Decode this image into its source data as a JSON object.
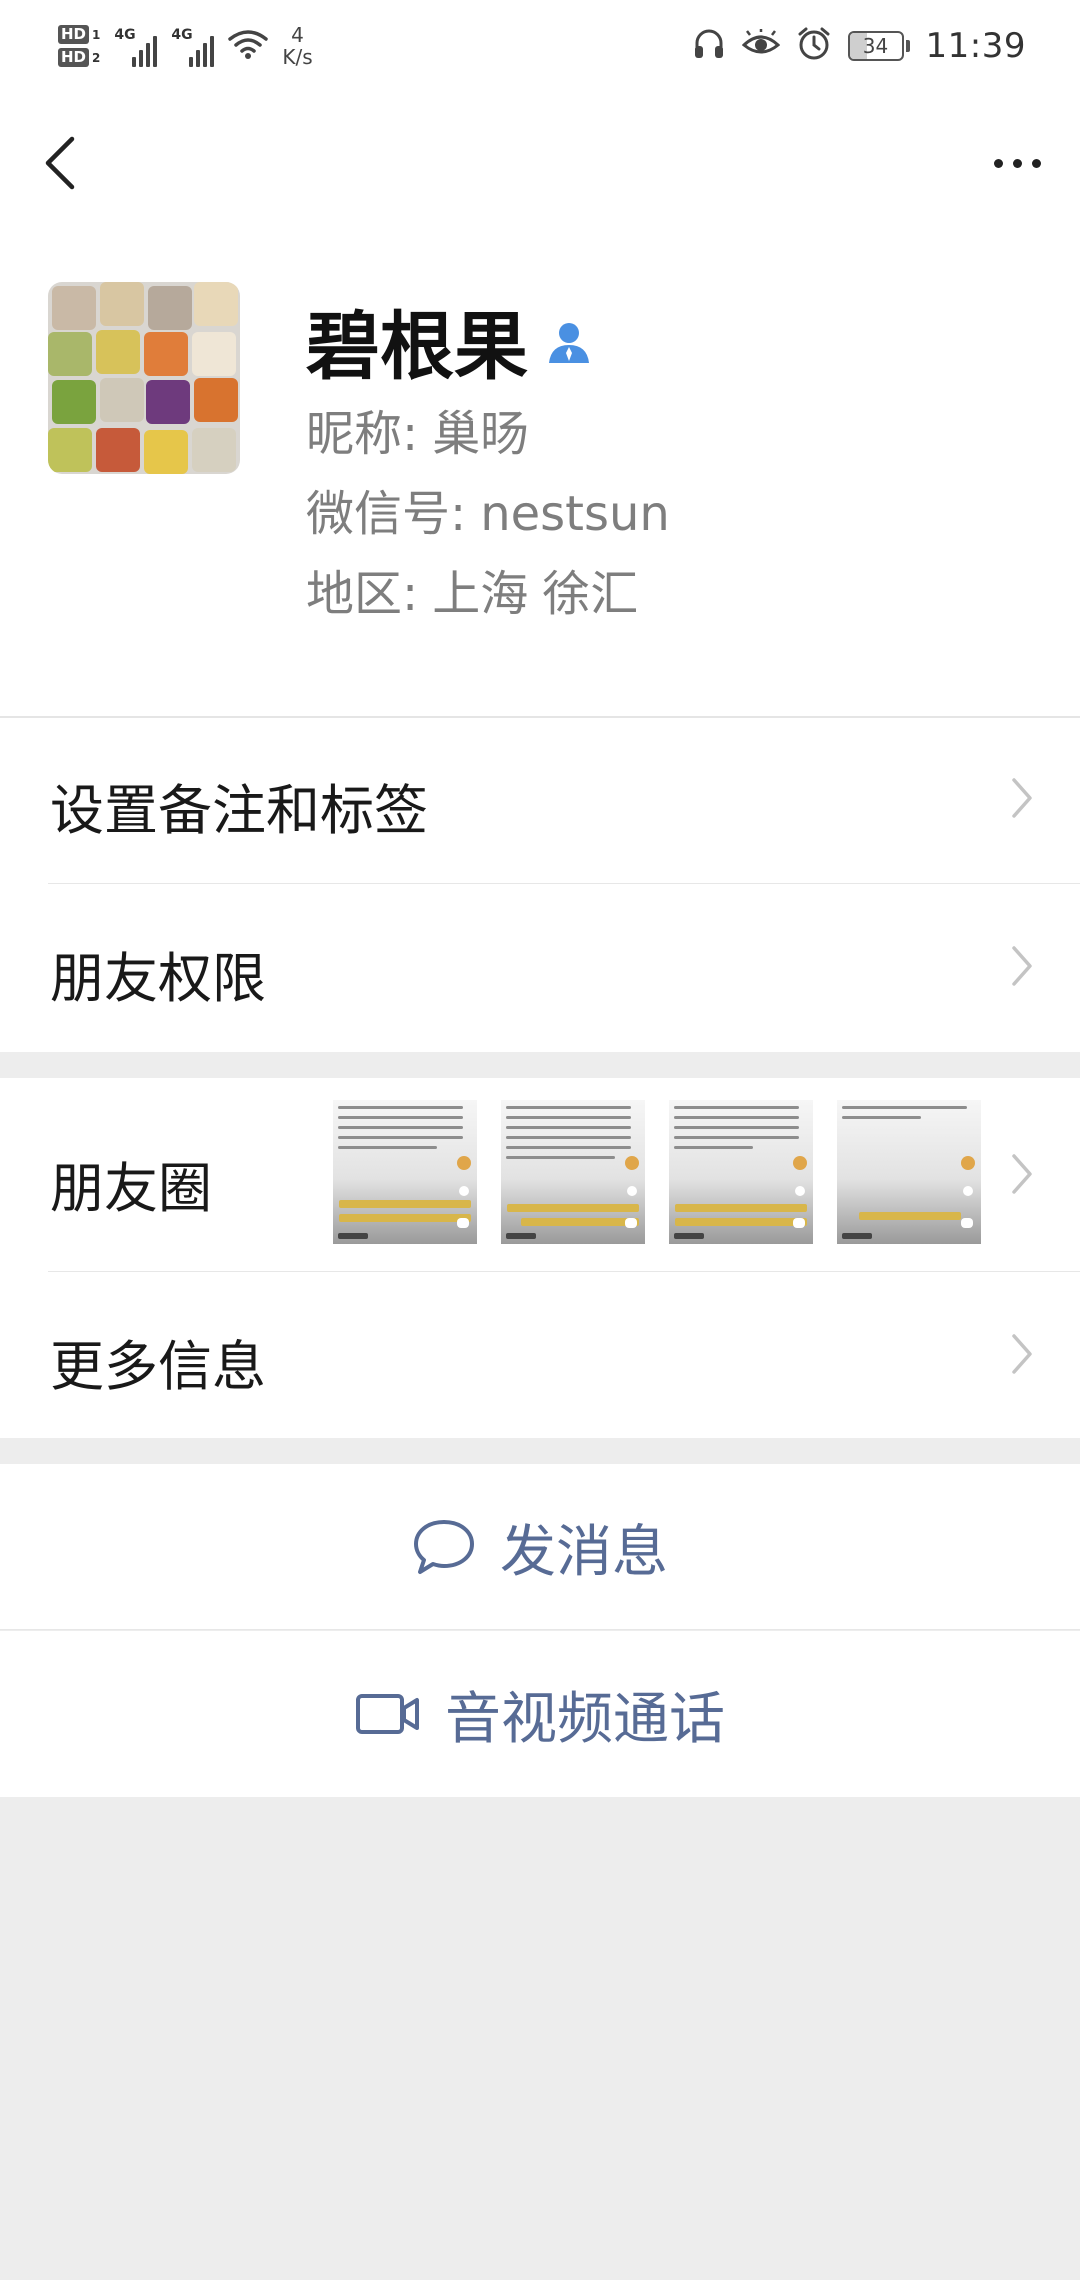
{
  "status_bar": {
    "hd1": "HD",
    "hd1_num": "1",
    "hd2": "HD",
    "hd2_num": "2",
    "signal1_label": "4G",
    "signal2_label": "4G",
    "speed_value": "4",
    "speed_unit": "K/s",
    "battery": "34",
    "time": "11:39",
    "icons": [
      "headphones-icon",
      "eye-icon",
      "alarm-icon",
      "battery-icon",
      "wifi-icon"
    ]
  },
  "profile": {
    "name": "碧根果",
    "nickname_label": "昵称:",
    "nickname_value": "巢旸",
    "wechat_id_label": "微信号:",
    "wechat_id_value": "nestsun",
    "region_label": "地区:",
    "region_province": "上海",
    "region_city": "徐汇"
  },
  "menu": {
    "remark_tags": "设置备注和标签",
    "friend_permissions": "朋友权限",
    "moments": "朋友圈",
    "more_info": "更多信息"
  },
  "actions": {
    "send_message": "发消息",
    "video_call": "音视频通话"
  },
  "colors": {
    "link_blue": "#576b95",
    "verified_icon": "#4a90e2",
    "background": "#ededed"
  }
}
